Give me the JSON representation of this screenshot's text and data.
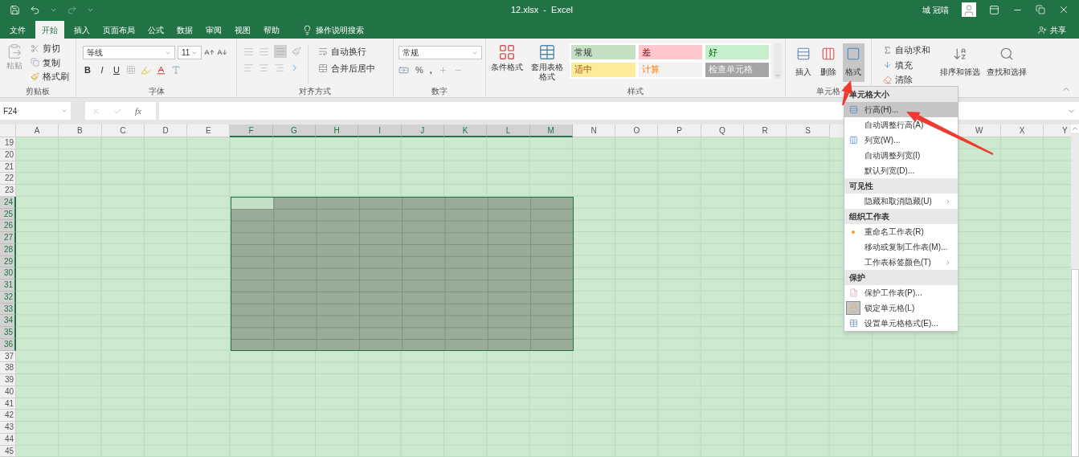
{
  "title_bar": {
    "title": "12.xlsx  -  Excel",
    "user": "城 冠喵"
  },
  "tabs": [
    {
      "label": "文件",
      "selected": false
    },
    {
      "label": "开始",
      "selected": true
    },
    {
      "label": "插入",
      "selected": false
    },
    {
      "label": "页面布局",
      "selected": false
    },
    {
      "label": "公式",
      "selected": false
    },
    {
      "label": "数据",
      "selected": false
    },
    {
      "label": "审阅",
      "selected": false
    },
    {
      "label": "视图",
      "selected": false
    },
    {
      "label": "帮助",
      "selected": false
    }
  ],
  "tell_me": "操作说明搜索",
  "share": "共享",
  "ribbon": {
    "clipboard": {
      "label": "剪贴板",
      "paste": "粘贴",
      "cut": "剪切",
      "copy": "复制",
      "format_painter": "格式刷"
    },
    "font": {
      "label": "字体",
      "font_name": "等线",
      "font_size": "11",
      "bold": "B",
      "italic": "I",
      "underline": "U"
    },
    "alignment": {
      "label": "对齐方式",
      "wrap": "自动换行",
      "merge": "合并后居中"
    },
    "number": {
      "label": "数字",
      "format": "常规",
      "percent": "%",
      "comma": ","
    },
    "styles": {
      "label": "样式",
      "conditional": "条件格式",
      "table": "套用表格格式",
      "cell_styles": [
        {
          "label": "常规",
          "kind": "normal",
          "color": "#c6e0c6"
        },
        {
          "label": "差",
          "kind": "bad",
          "color": "#ffc7ce"
        },
        {
          "label": "好",
          "kind": "good",
          "color": "#c6efce"
        },
        {
          "label": "适中",
          "kind": "neutral",
          "color": "#ffeb9c"
        },
        {
          "label": "计算",
          "kind": "calculation",
          "color": "#f2f2f2"
        },
        {
          "label": "检查单元格",
          "kind": "check",
          "color": "#a5a5a5"
        }
      ]
    },
    "cells": {
      "label": "单元格",
      "buttons": [
        {
          "label": "插入",
          "selected": false
        },
        {
          "label": "删除",
          "selected": false
        },
        {
          "label": "格式",
          "selected": true
        }
      ]
    },
    "editing": {
      "autosum": "自动求和",
      "fill": "填充",
      "clear": "清除",
      "sort": "排序和筛选",
      "find": "查找和选择"
    }
  },
  "formula_bar": {
    "name_box": "F24",
    "function_label": "fx"
  },
  "sheet": {
    "columns_left": [
      {
        "label": "A",
        "selected": false
      },
      {
        "label": "B",
        "selected": false
      },
      {
        "label": "C",
        "selected": false
      },
      {
        "label": "D",
        "selected": false
      },
      {
        "label": "E",
        "selected": false
      },
      {
        "label": "F",
        "selected": true
      },
      {
        "label": "G",
        "selected": true
      },
      {
        "label": "H",
        "selected": true
      },
      {
        "label": "I",
        "selected": true
      },
      {
        "label": "J",
        "selected": true
      },
      {
        "label": "K",
        "selected": true
      },
      {
        "label": "L",
        "selected": true
      },
      {
        "label": "M",
        "selected": true
      },
      {
        "label": "N",
        "selected": false
      },
      {
        "label": "O",
        "selected": false
      },
      {
        "label": "P",
        "selected": false
      },
      {
        "label": "Q",
        "selected": false
      },
      {
        "label": "R",
        "selected": false
      },
      {
        "label": "S",
        "selected": false
      }
    ],
    "columns_right": [
      {
        "label": "W",
        "selected": false
      },
      {
        "label": "X",
        "selected": false
      },
      {
        "label": "Y",
        "selected": false
      }
    ],
    "rows": [
      {
        "label": "19",
        "selected": false
      },
      {
        "label": "20",
        "selected": false
      },
      {
        "label": "21",
        "selected": false
      },
      {
        "label": "22",
        "selected": false
      },
      {
        "label": "23",
        "selected": false
      },
      {
        "label": "24",
        "selected": true
      },
      {
        "label": "25",
        "selected": true
      },
      {
        "label": "26",
        "selected": true
      },
      {
        "label": "27",
        "selected": true
      },
      {
        "label": "28",
        "selected": true
      },
      {
        "label": "29",
        "selected": true
      },
      {
        "label": "30",
        "selected": true
      },
      {
        "label": "31",
        "selected": true
      },
      {
        "label": "32",
        "selected": true
      },
      {
        "label": "33",
        "selected": true
      },
      {
        "label": "34",
        "selected": true
      },
      {
        "label": "35",
        "selected": true
      },
      {
        "label": "36",
        "selected": true
      },
      {
        "label": "37",
        "selected": false
      },
      {
        "label": "38",
        "selected": false
      },
      {
        "label": "39",
        "selected": false
      },
      {
        "label": "40",
        "selected": false
      },
      {
        "label": "41",
        "selected": false
      },
      {
        "label": "42",
        "selected": false
      },
      {
        "label": "43",
        "selected": false
      },
      {
        "label": "44",
        "selected": false
      },
      {
        "label": "45",
        "selected": false
      }
    ]
  },
  "context_menu": [
    {
      "heading": "单元格大小",
      "items": [
        {
          "label": "行高(H)...",
          "kind": "row-height",
          "selected": true,
          "checked": false,
          "submenu": false
        },
        {
          "label": "自动调整行高(A)",
          "kind": "plain",
          "selected": false,
          "checked": false,
          "submenu": false
        },
        {
          "label": "列宽(W)...",
          "kind": "column-width",
          "selected": false,
          "checked": false,
          "submenu": false
        },
        {
          "label": "自动调整列宽(I)",
          "kind": "plain",
          "selected": false,
          "checked": false,
          "submenu": false
        },
        {
          "label": "默认列宽(D)...",
          "kind": "plain",
          "selected": false,
          "checked": false,
          "submenu": false
        }
      ]
    },
    {
      "heading": "可见性",
      "items": [
        {
          "label": "隐藏和取消隐藏(U)",
          "kind": "plain",
          "selected": false,
          "checked": false,
          "submenu": true
        }
      ]
    },
    {
      "heading": "组织工作表",
      "items": [
        {
          "label": "重命名工作表(R)",
          "kind": "bullet",
          "selected": false,
          "checked": false,
          "submenu": false
        },
        {
          "label": "移动或复制工作表(M)...",
          "kind": "plain",
          "selected": false,
          "checked": false,
          "submenu": false
        },
        {
          "label": "工作表标签颜色(T)",
          "kind": "plain",
          "selected": false,
          "checked": false,
          "submenu": true
        }
      ]
    },
    {
      "heading": "保护",
      "items": [
        {
          "label": "保护工作表(P)...",
          "kind": "protect",
          "selected": false,
          "checked": false,
          "submenu": false
        },
        {
          "label": "锁定单元格(L)",
          "kind": "lock",
          "selected": false,
          "checked": true,
          "submenu": false
        },
        {
          "label": "设置单元格格式(E)...",
          "kind": "format",
          "selected": false,
          "checked": false,
          "submenu": false
        }
      ]
    }
  ],
  "annotations": [
    {
      "kind": "arrow",
      "color": "#ee3a2f"
    },
    {
      "kind": "arrow",
      "color": "#ee3a2f"
    }
  ]
}
